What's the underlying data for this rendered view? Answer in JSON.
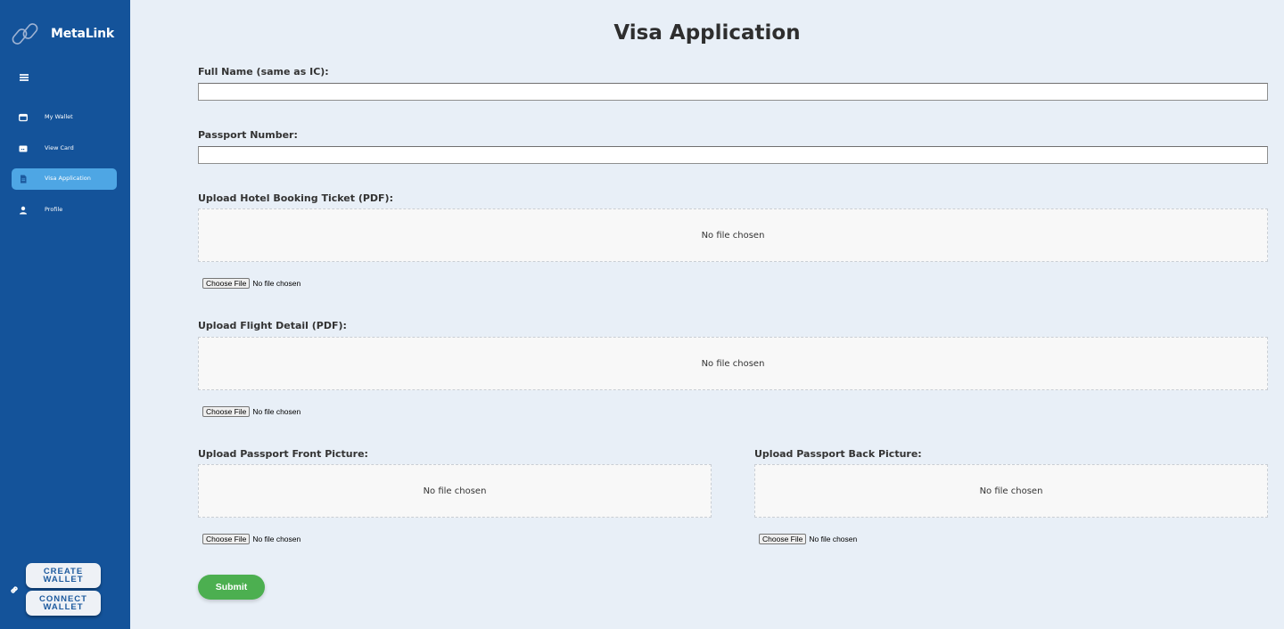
{
  "app": {
    "brand_name": "MetaLink"
  },
  "sidebar": {
    "menu_icon": "hamburger-icon",
    "items": [
      {
        "label": "My Wallet",
        "icon": "wallet-icon",
        "active": false
      },
      {
        "label": "View Card",
        "icon": "card-icon",
        "active": false
      },
      {
        "label": "Visa Application",
        "icon": "document-icon",
        "active": true
      },
      {
        "label": "Profile",
        "icon": "user-icon",
        "active": false
      }
    ],
    "create_wallet_label": "CREATE WALLET",
    "connect_wallet_label": "CONNECT WALLET"
  },
  "form": {
    "title": "Visa Application",
    "full_name": {
      "label": "Full Name (same as IC):",
      "value": ""
    },
    "passport_number": {
      "label": "Passport Number:",
      "value": ""
    },
    "hotel_booking": {
      "label": "Upload Hotel Booking Ticket (PDF):",
      "preview_text": "No file chosen",
      "button_label": "Choose File",
      "status": "No file chosen"
    },
    "flight_detail": {
      "label": "Upload Flight Detail (PDF):",
      "preview_text": "No file chosen",
      "button_label": "Choose File",
      "status": "No file chosen"
    },
    "passport_front": {
      "label": "Upload Passport Front Picture:",
      "preview_text": "No file chosen",
      "button_label": "Choose File",
      "status": "No file chosen"
    },
    "passport_back": {
      "label": "Upload Passport Back Picture:",
      "preview_text": "No file chosen",
      "button_label": "Choose File",
      "status": "No file chosen"
    },
    "submit_label": "Submit"
  },
  "colors": {
    "sidebar_bg": "#14539a",
    "active_item": "#4ea6e4",
    "page_bg": "#e8eff7",
    "submit": "#4caf50"
  }
}
